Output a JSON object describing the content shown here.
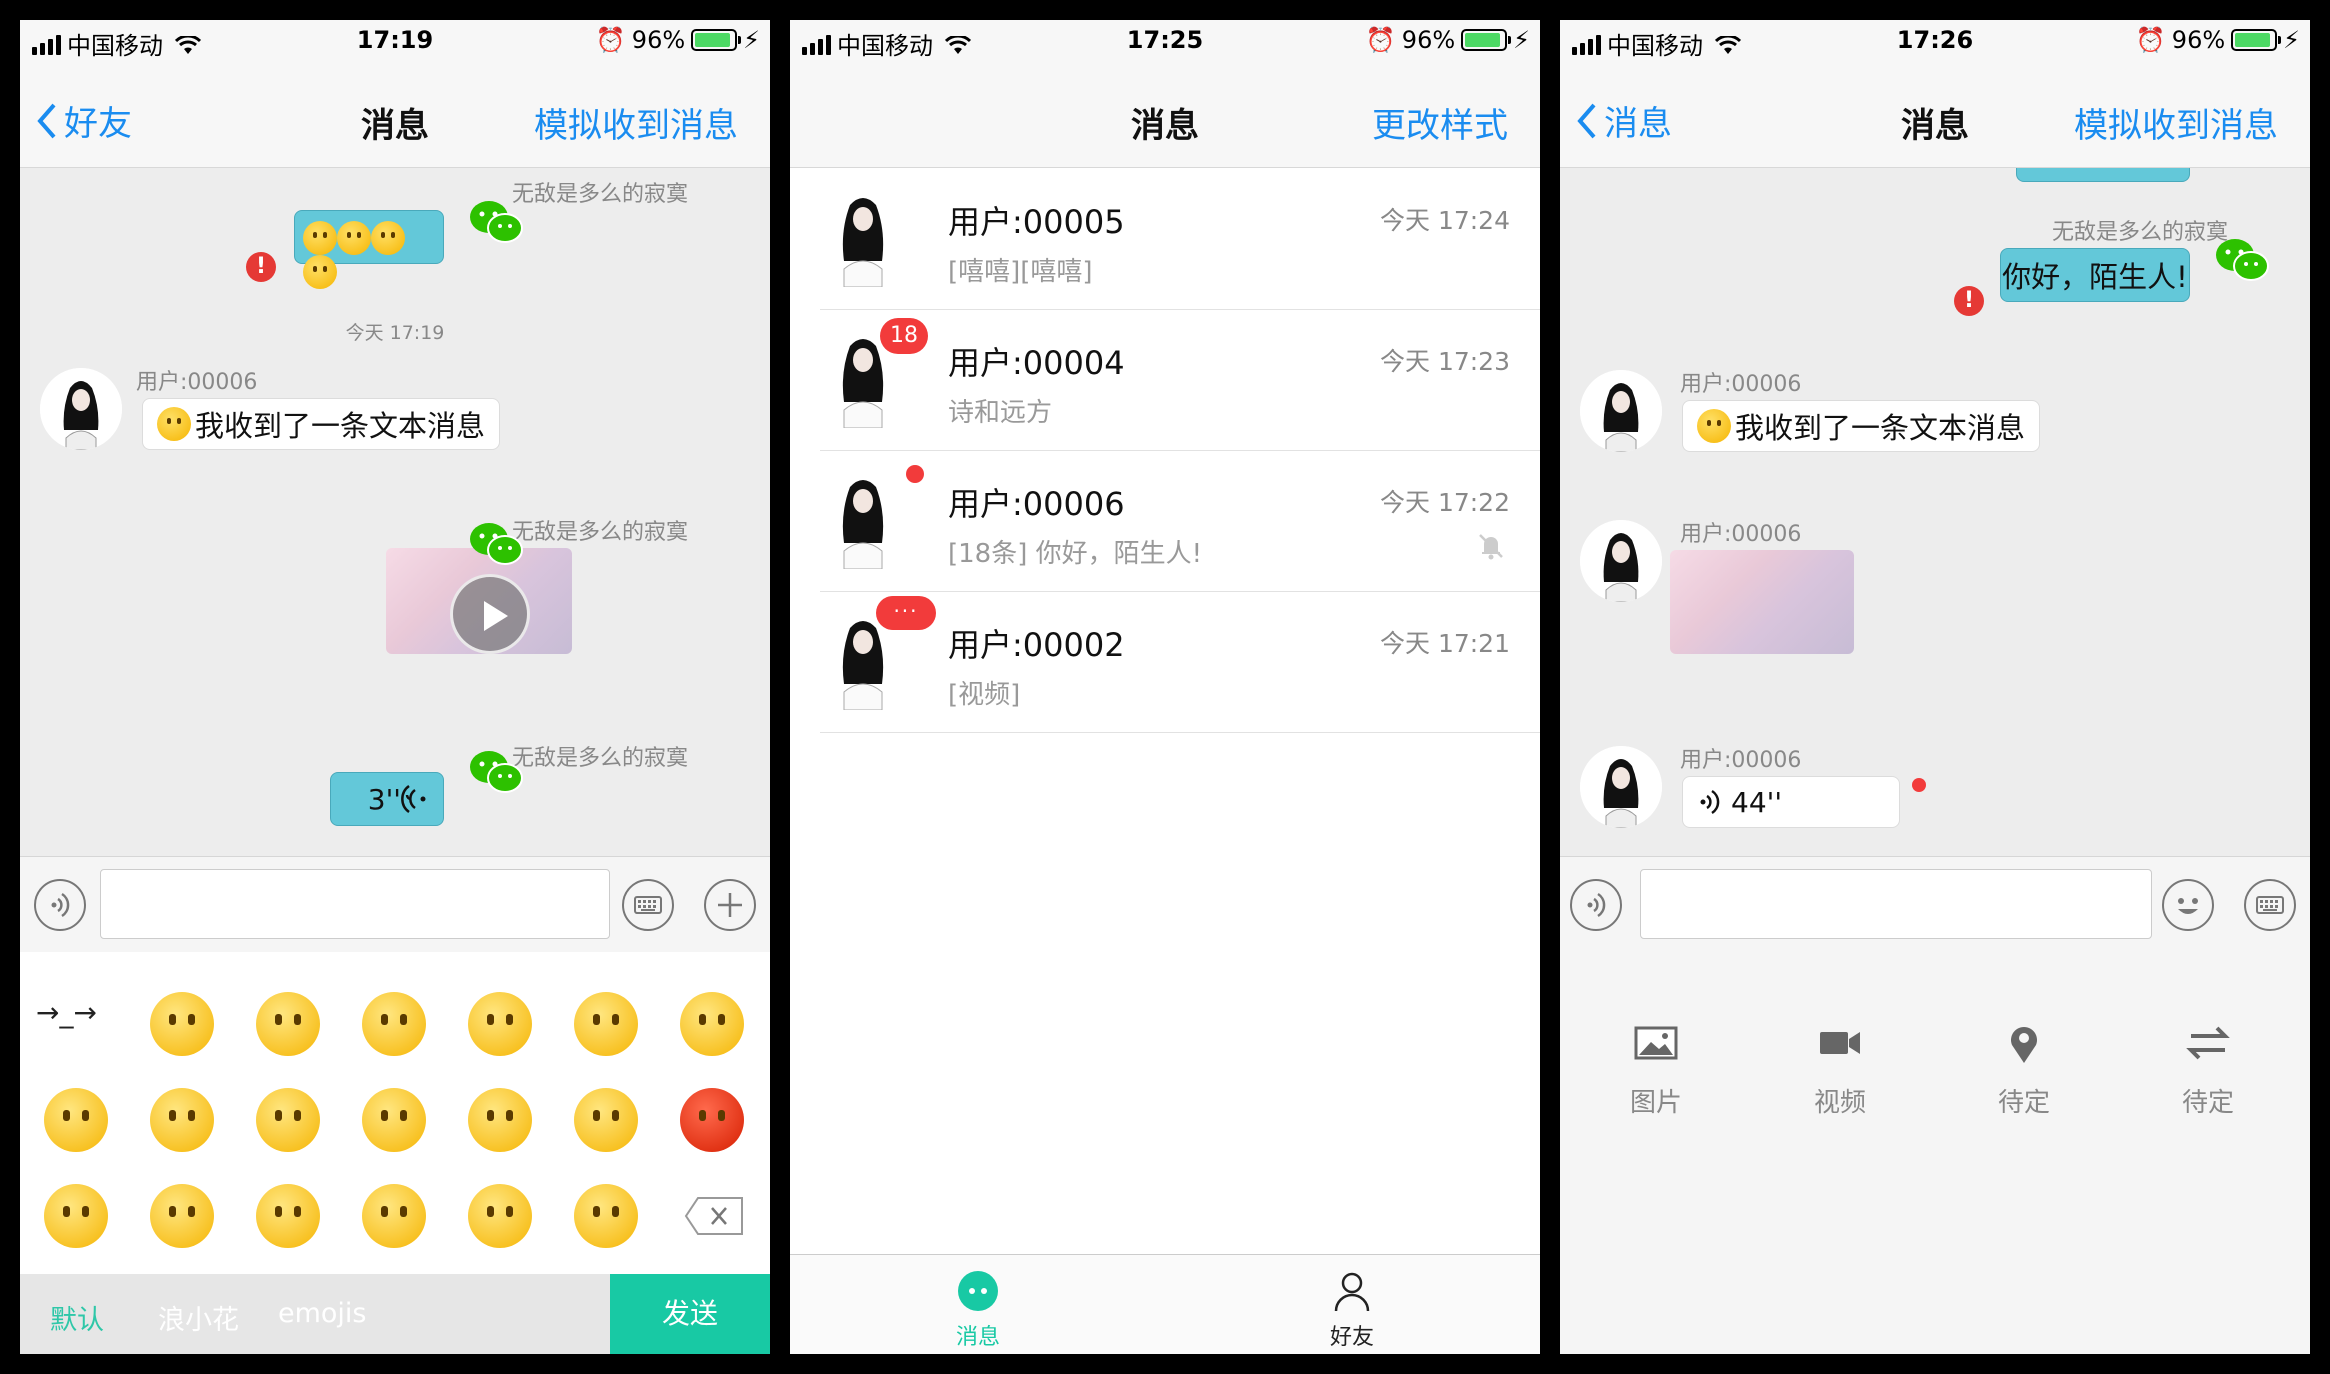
{
  "status_bars": [
    {
      "carrier": "中国移动",
      "time": "17:19",
      "battery": "96%"
    },
    {
      "carrier": "中国移动",
      "time": "17:25",
      "battery": "96%"
    },
    {
      "carrier": "中国移动",
      "time": "17:26",
      "battery": "96%"
    }
  ],
  "chat1": {
    "back_label": "好友",
    "title": "消息",
    "right_action": "模拟收到消息",
    "my_name": "无敌是多么的寂寞",
    "timestamp": "今天 17:19",
    "peer_name": "用户:00006",
    "peer_text": "我收到了一条文本消息",
    "voice_duration": "3''",
    "error_mark": "!",
    "input_placeholder": "",
    "kaomoji": "→_→",
    "emoji_tabs": [
      "默认",
      "浪小花",
      "emojis"
    ],
    "send_label": "发送"
  },
  "list": {
    "title": "消息",
    "right_action": "更改样式",
    "conversations": [
      {
        "name": "用户:00005",
        "time": "今天 17:24",
        "last": "[嘻嘻][嘻嘻]",
        "badge": ""
      },
      {
        "name": "用户:00004",
        "time": "今天 17:23",
        "last": "诗和远方",
        "badge": "18"
      },
      {
        "name": "用户:00006",
        "time": "今天 17:22",
        "last": "[18条] 你好，陌生人!",
        "badge": "dot"
      },
      {
        "name": "用户:00002",
        "time": "今天 17:21",
        "last": "[视频]",
        "badge": "···"
      }
    ],
    "tabs": [
      {
        "label": "消息",
        "icon": "chat-bubble-icon",
        "active": true
      },
      {
        "label": "好友",
        "icon": "person-icon",
        "active": false
      }
    ],
    "colors": {
      "accent": "#18c9a4",
      "badge": "#f23b3b",
      "link": "#1a8cf0"
    }
  },
  "chat2": {
    "back_label": "消息",
    "title": "消息",
    "right_action": "模拟收到消息",
    "my_name": "无敌是多么的寂寞",
    "my_text": "你好，陌生人!",
    "peer_name": "用户:00006",
    "peer_text": "我收到了一条文本消息",
    "voice_duration": "44''",
    "error_mark": "!",
    "functions": [
      {
        "label": "图片",
        "icon": "image-icon"
      },
      {
        "label": "视频",
        "icon": "video-camera-icon"
      },
      {
        "label": "待定",
        "icon": "location-pin-icon"
      },
      {
        "label": "待定",
        "icon": "swap-arrows-icon"
      }
    ]
  }
}
